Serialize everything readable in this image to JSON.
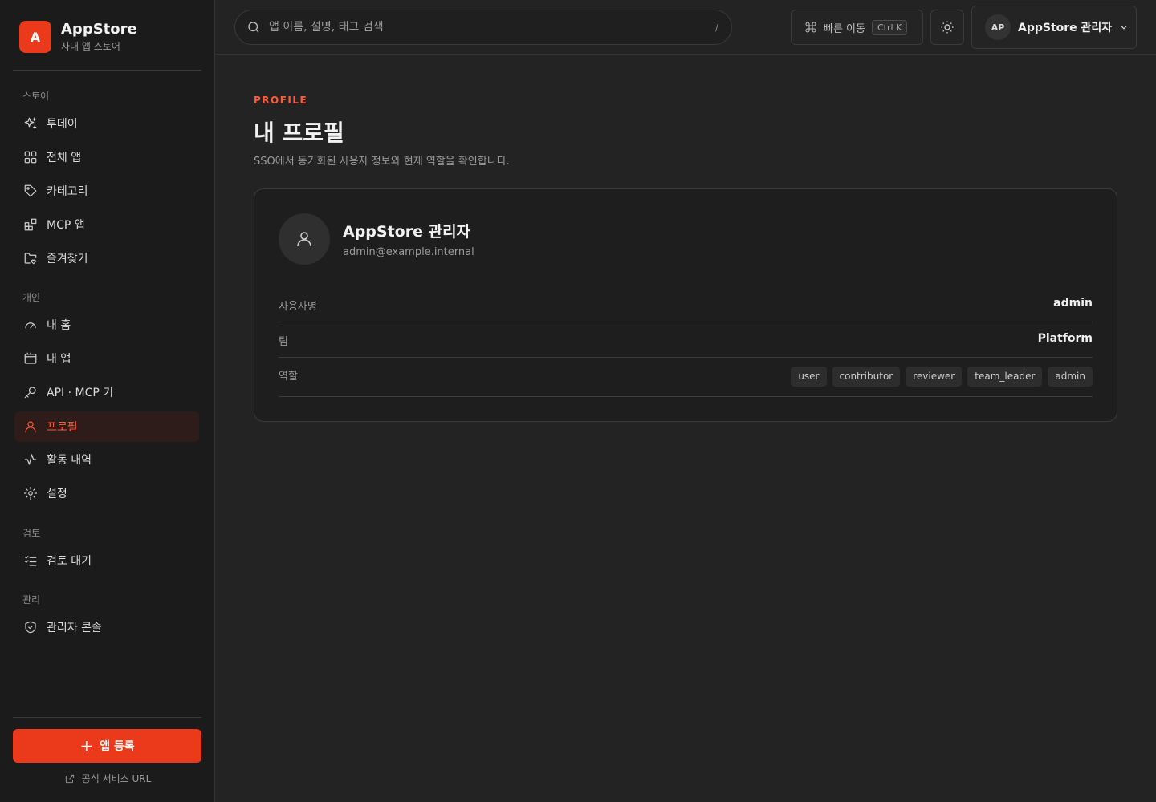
{
  "brand": {
    "logo": "A",
    "title": "AppStore",
    "subtitle": "사내 앱 스토어"
  },
  "sidebar": {
    "sections": [
      {
        "label": "스토어",
        "items": [
          {
            "label": "투데이",
            "icon": "sparkles-icon"
          },
          {
            "label": "전체 앱",
            "icon": "grid-icon"
          },
          {
            "label": "카테고리",
            "icon": "tag-icon"
          },
          {
            "label": "MCP 앱",
            "icon": "blocks-icon"
          },
          {
            "label": "즐겨찾기",
            "icon": "folder-heart-icon"
          }
        ]
      },
      {
        "label": "개인",
        "items": [
          {
            "label": "내 홈",
            "icon": "gauge-icon"
          },
          {
            "label": "내 앱",
            "icon": "window-icon"
          },
          {
            "label": "API · MCP 키",
            "icon": "key-icon"
          },
          {
            "label": "프로필",
            "icon": "user-icon",
            "active": true
          },
          {
            "label": "활동 내역",
            "icon": "activity-icon"
          },
          {
            "label": "설정",
            "icon": "gear-icon"
          }
        ]
      },
      {
        "label": "검토",
        "items": [
          {
            "label": "검토 대기",
            "icon": "list-checks-icon"
          }
        ]
      },
      {
        "label": "관리",
        "items": [
          {
            "label": "관리자 콘솔",
            "icon": "shield-icon"
          }
        ]
      }
    ],
    "register_label": "앱 등록",
    "official_link": "공식 서비스 URL"
  },
  "header": {
    "search_placeholder": "앱 이름, 설명, 태그 검색",
    "search_shortcut": "/",
    "quick_label": "빠른 이동",
    "quick_kbd": "Ctrl K",
    "user_initials": "AP",
    "user_name": "AppStore 관리자"
  },
  "main": {
    "eyebrow": "PROFILE",
    "title": "내 프로필",
    "description": "SSO에서 동기화된 사용자 정보와 현재 역할을 확인합니다.",
    "profile": {
      "name": "AppStore 관리자",
      "email": "admin@example.internal",
      "username_label": "사용자명",
      "username": "admin",
      "team_label": "팀",
      "team": "Platform",
      "roles_label": "역할",
      "roles": [
        "user",
        "contributor",
        "reviewer",
        "team_leader",
        "admin"
      ]
    }
  },
  "colors": {
    "accent": "#ea3a1b",
    "background": "#232323",
    "sidebar": "#1b1b1b"
  }
}
